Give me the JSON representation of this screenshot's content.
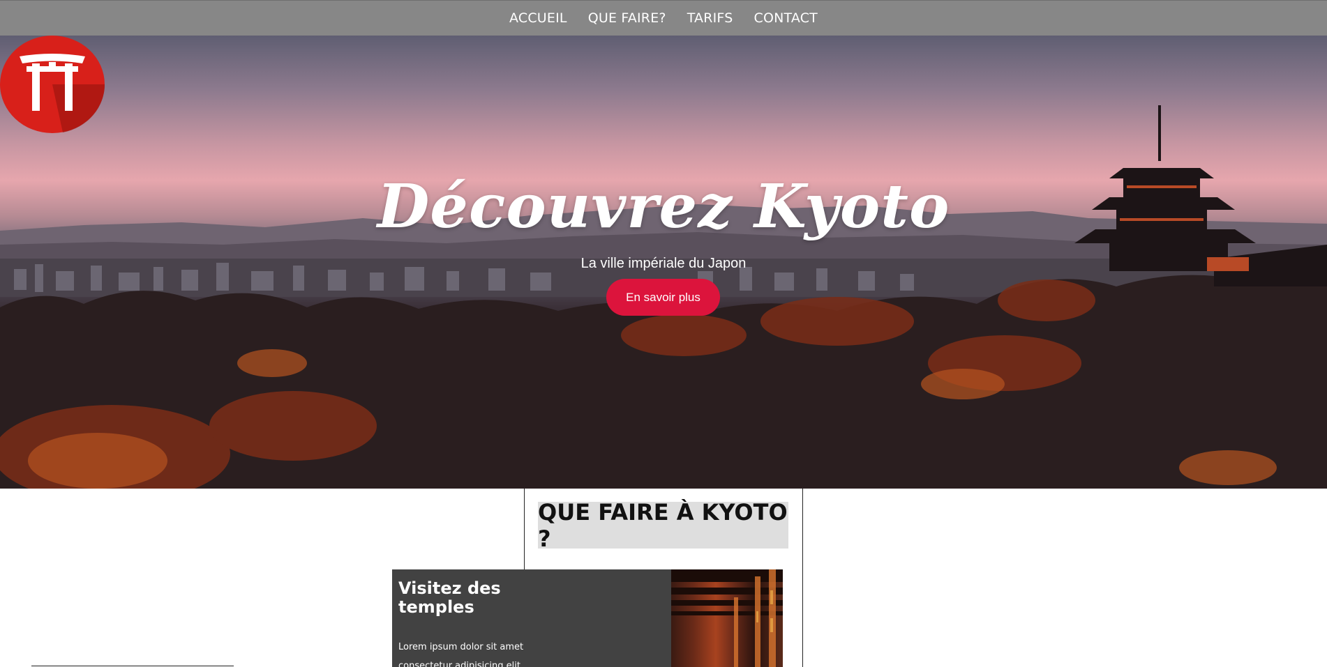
{
  "nav": {
    "items": [
      {
        "label": "ACCUEIL"
      },
      {
        "label": "QUE FAIRE?"
      },
      {
        "label": "TARIFS"
      },
      {
        "label": "CONTACT"
      }
    ]
  },
  "hero": {
    "logo_icon": "torii-gate-icon",
    "title": "Découvrez Kyoto",
    "subtitle": "La ville impériale du Japon",
    "cta_label": "En savoir plus"
  },
  "section": {
    "title": "QUE FAIRE À KYOTO ?",
    "card": {
      "title": "Visitez des temples",
      "text": "Lorem ipsum dolor sit amet consectetur adipisicing elit.",
      "image_icon": "temple-photo"
    }
  },
  "colors": {
    "nav_bg": "#878787",
    "accent": "#dc143c",
    "logo_red": "#d8201a",
    "card_bg": "#424242",
    "section_title_bg": "#dedede"
  }
}
